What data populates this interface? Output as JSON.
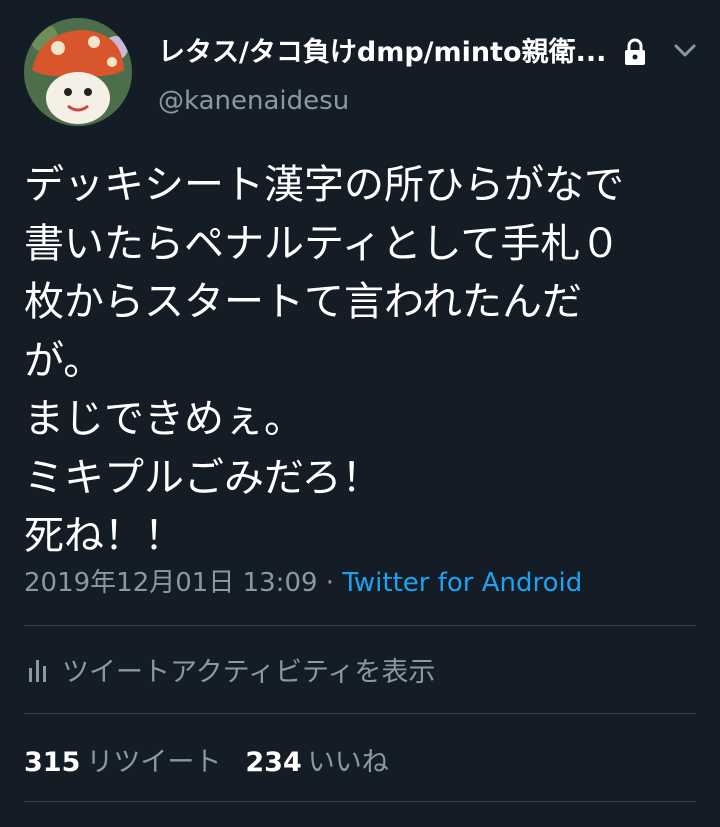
{
  "user": {
    "display_name": "レタス/タコ負けdmp/minto親衛...",
    "handle": "@kanenaidesu"
  },
  "icons": {
    "avatar": "mushroom-avatar",
    "lock": "lock-icon",
    "menu": "chevron-down-icon",
    "activity": "bar-chart-icon"
  },
  "tweet": {
    "text": "デッキシート漢字の所ひらがなで\n書いたらペナルティとして手札０\n枚からスタートて言われたんだ\nが。\nまじできめぇ。\nミキプルごみだろ！\n死ね！！",
    "timestamp": "2019年12月01日 13:09",
    "separator": " · ",
    "source": "Twitter for Android"
  },
  "activity": {
    "label": "ツイートアクティビティを表示"
  },
  "stats": {
    "retweets_count": "315",
    "retweets_label": "リツイート",
    "likes_count": "234",
    "likes_label": "いいね"
  },
  "colors": {
    "background": "#141d26",
    "text": "#ffffff",
    "secondary": "#8899a6",
    "link": "#1da1f2",
    "divider": "#38444d"
  }
}
